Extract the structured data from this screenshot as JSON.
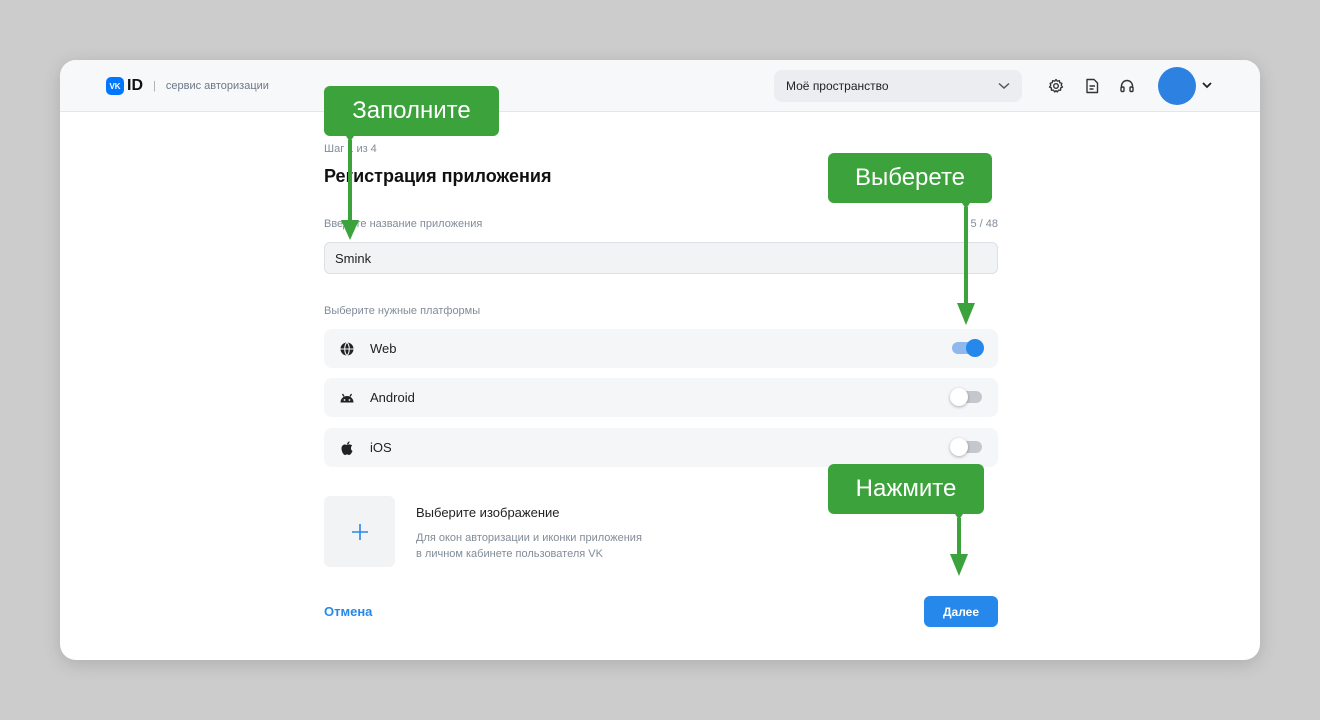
{
  "header": {
    "logo_badge": "VK",
    "logo_id": "ID",
    "logo_sep": "|",
    "logo_subtitle": "сервис авторизации",
    "space_select": "Моё пространство"
  },
  "form": {
    "step": "Шаг 1 из 4",
    "title": "Регистрация приложения",
    "name_label": "Введите название приложения",
    "name_counter": "5 / 48",
    "name_value": "Smink",
    "platforms_label": "Выберите нужные платформы",
    "platforms": [
      {
        "name": "Web",
        "icon": "globe-icon",
        "enabled": true
      },
      {
        "name": "Android",
        "icon": "android-icon",
        "enabled": false
      },
      {
        "name": "iOS",
        "icon": "apple-icon",
        "enabled": false
      }
    ],
    "image_title": "Выберите изображение",
    "image_desc_line1": "Для окон авторизации и иконки приложения",
    "image_desc_line2": "в личном кабинете пользователя VK",
    "cancel_label": "Отмена",
    "next_label": "Далее"
  },
  "callouts": {
    "fill": "Заполните",
    "choose": "Выберете",
    "press": "Нажмите"
  },
  "colors": {
    "accent": "#2688eb",
    "callout": "#3ca23c",
    "avatar": "#2d81e0"
  }
}
